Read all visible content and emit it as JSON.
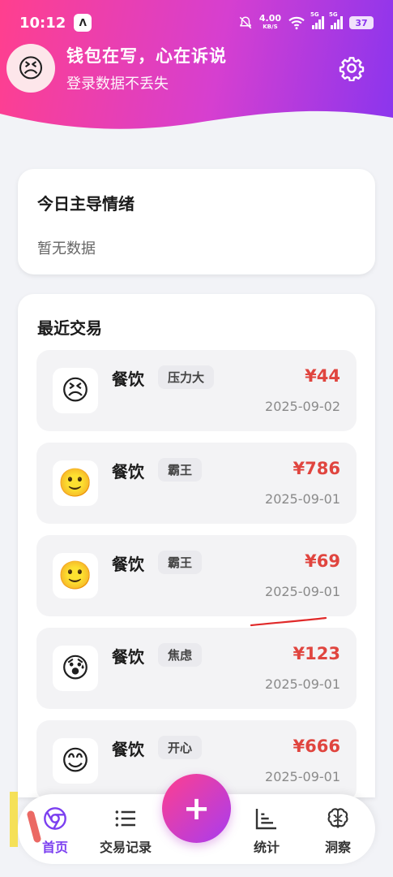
{
  "status_bar": {
    "time": "10:12",
    "net_speed": "4.00",
    "net_unit": "KB/S",
    "signal1": "5G",
    "signal2": "5G",
    "battery": "37"
  },
  "profile": {
    "avatar_emoji": "😣",
    "title": "钱包在写，心在诉说",
    "subtitle": "登录数据不丢失"
  },
  "mood_card": {
    "title": "今日主导情绪",
    "empty_text": "暂无数据"
  },
  "recent": {
    "title": "最近交易",
    "items": [
      {
        "emoji": "😣",
        "category": "餐饮",
        "tag": "压力大",
        "amount": "¥44",
        "date": "2025-09-02"
      },
      {
        "emoji": "🙂",
        "category": "餐饮",
        "tag": "霸王",
        "amount": "¥786",
        "date": "2025-09-01"
      },
      {
        "emoji": "🙂",
        "category": "餐饮",
        "tag": "霸王",
        "amount": "¥69",
        "date": "2025-09-01"
      },
      {
        "emoji": "😰",
        "category": "餐饮",
        "tag": "焦虑",
        "amount": "¥123",
        "date": "2025-09-01"
      },
      {
        "emoji": "😊",
        "category": "餐饮",
        "tag": "开心",
        "amount": "¥666",
        "date": "2025-09-01"
      }
    ]
  },
  "nav": {
    "home": "首页",
    "records": "交易记录",
    "add": "+",
    "stats": "统计",
    "insights": "洞察"
  },
  "colors": {
    "accent": "#7b3ff0",
    "brand_pink": "#ff3f8e",
    "amount_red": "#e0453f"
  }
}
